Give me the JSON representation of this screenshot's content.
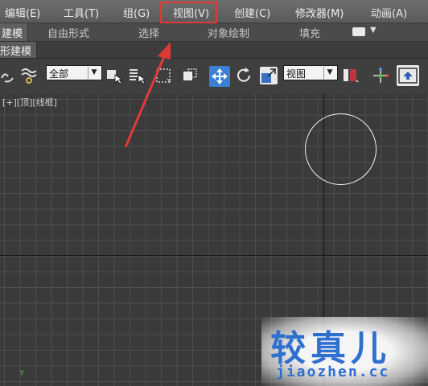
{
  "menu": {
    "items": [
      "编辑(E)",
      "工具(T)",
      "组(G)",
      "视图(V)",
      "创建(C)",
      "修改器(M)",
      "动画(A)"
    ],
    "highlighted": "视图(V)"
  },
  "ribbon": {
    "active_tab": "建模",
    "tabs": [
      "自由形式",
      "选择",
      "对象绘制",
      "填充"
    ]
  },
  "subpanel": {
    "label": "形建模"
  },
  "toolbar": {
    "selection_filter": "全部",
    "reference_coord": "视图"
  },
  "viewport": {
    "label": "[+][顶][线框]",
    "axis_label": "Y"
  },
  "watermark": {
    "title": "较真儿",
    "url": "jiaozhen.cc"
  },
  "colors": {
    "annotation_red": "#e03a36",
    "toolbar_active_blue": "#3d7fd1",
    "watermark_blue": "#2f6fd0"
  }
}
